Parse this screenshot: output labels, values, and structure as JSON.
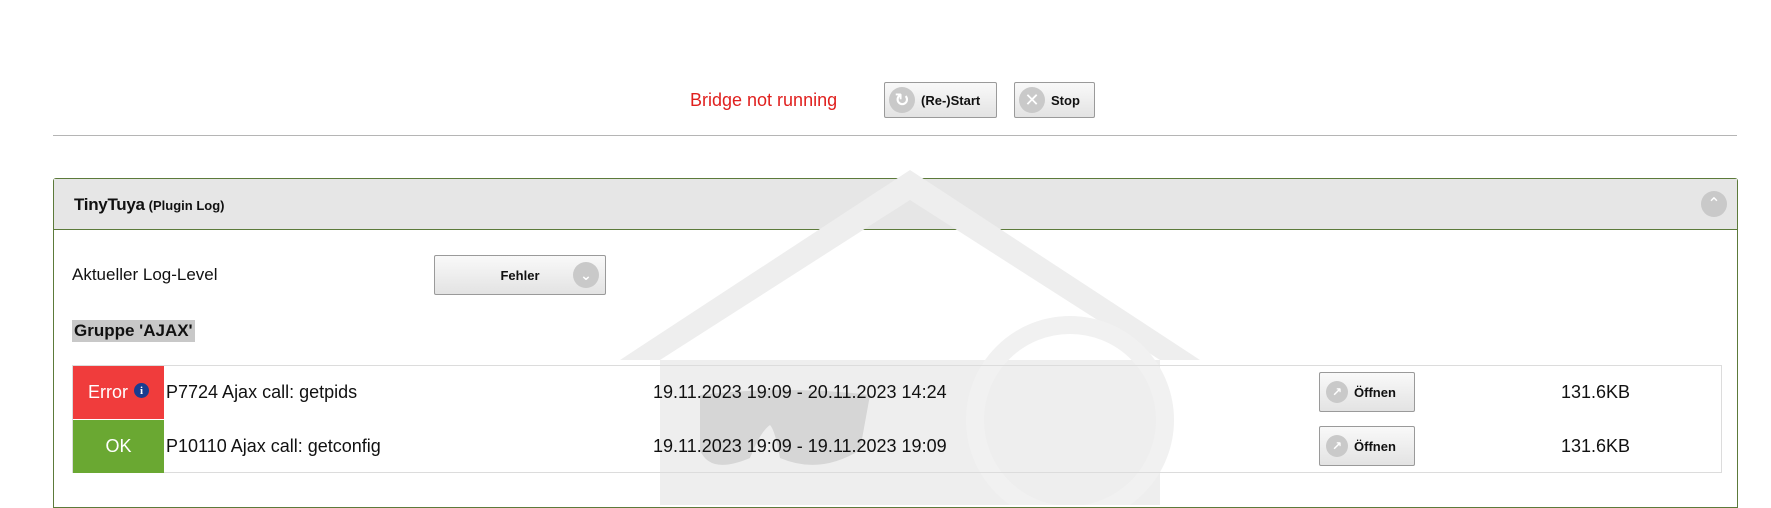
{
  "header": {
    "status": "Bridge not running",
    "restart_label": "(Re-)Start",
    "stop_label": "Stop"
  },
  "panel": {
    "title": "TinyTuya",
    "subtitle": "(Plugin Log)"
  },
  "log_level": {
    "label": "Aktueller Log-Level",
    "selected": "Fehler"
  },
  "group": {
    "title": "Gruppe 'AJAX'"
  },
  "logs": [
    {
      "status": "Error",
      "name": "P7724 Ajax call: getpids",
      "time": "19.11.2023 19:09 - 20.11.2023 14:24",
      "open_label": "Öffnen",
      "size": "131.6KB"
    },
    {
      "status": "OK",
      "name": "P10110 Ajax call: getconfig",
      "time": "19.11.2023 19:09 - 19.11.2023 19:09",
      "open_label": "Öffnen",
      "size": "131.6KB"
    }
  ],
  "colors": {
    "error": "#f03c3c",
    "ok": "#6aa832",
    "status_text": "#e0201e",
    "panel_border": "#5c7a3a"
  },
  "icons": {
    "restart": "refresh-icon",
    "stop": "close-icon",
    "collapse": "chevron-up-icon",
    "select": "chevron-down-icon",
    "info": "info-icon",
    "open": "external-link-icon"
  }
}
